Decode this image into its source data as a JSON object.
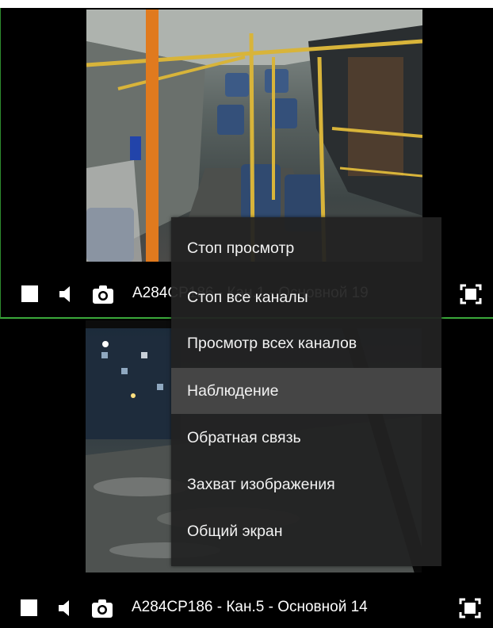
{
  "panels": [
    {
      "channel_label": "A284CP186 - Кан.1 - Основной 19",
      "controls": {
        "stop_icon": "stop-square-icon",
        "sound_icon": "speaker-icon",
        "snapshot_icon": "camera-icon",
        "fullscreen_icon": "fullscreen-icon"
      }
    },
    {
      "channel_label": "A284CP186 - Кан.5 - Основной 14",
      "controls": {
        "stop_icon": "stop-square-icon",
        "sound_icon": "speaker-icon",
        "snapshot_icon": "camera-icon",
        "fullscreen_icon": "fullscreen-icon"
      }
    }
  ],
  "context_menu": {
    "items": [
      {
        "label": "Стоп просмотр"
      },
      {
        "label": "Стоп все каналы"
      },
      {
        "label": "Просмотр всех каналов"
      },
      {
        "label": "Наблюдение",
        "highlighted": true
      },
      {
        "label": "Обратная связь"
      },
      {
        "label": "Захват изображения"
      },
      {
        "label": "Общий экран"
      }
    ]
  },
  "colors": {
    "panel_background": "#000000",
    "selected_border": "#3aa83a",
    "menu_background": "#222222",
    "menu_hover": "#454545",
    "text": "#ffffff",
    "bus_rail_yellow": "#d8b43a",
    "bus_pole_orange": "#e07a1e",
    "seat_blue": "#3c5a86"
  }
}
